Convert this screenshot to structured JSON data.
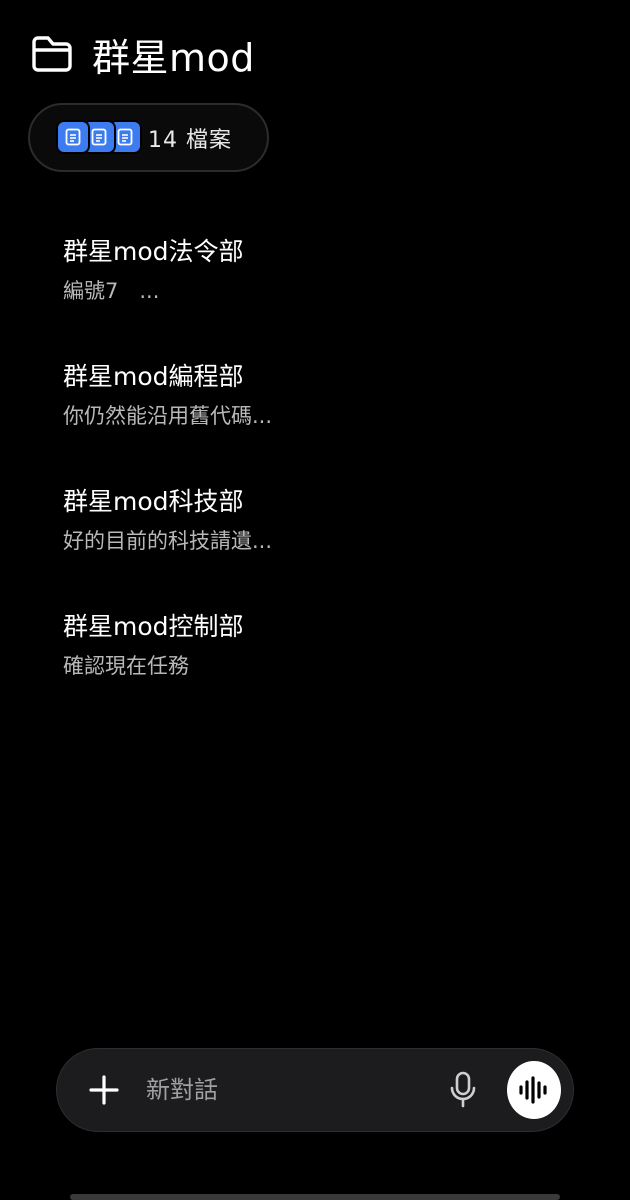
{
  "header": {
    "title": "群星mod",
    "icon": "folder-icon"
  },
  "files": {
    "count_label": "14 檔案",
    "icon": "document-icon",
    "accent_color": "#3d7cf0"
  },
  "conversations": [
    {
      "title": "群星mod法令部",
      "preview": "編號7　..."
    },
    {
      "title": "群星mod編程部",
      "preview": "你仍然能沿用舊代碼..."
    },
    {
      "title": "群星mod科技部",
      "preview": "好的目前的科技請遺..."
    },
    {
      "title": "群星mod控制部",
      "preview": "確認現在任務"
    }
  ],
  "composer": {
    "placeholder": "新對話",
    "value": "",
    "plus_icon": "plus-icon",
    "mic_icon": "microphone-icon",
    "voice_icon": "voice-waveform-icon"
  }
}
